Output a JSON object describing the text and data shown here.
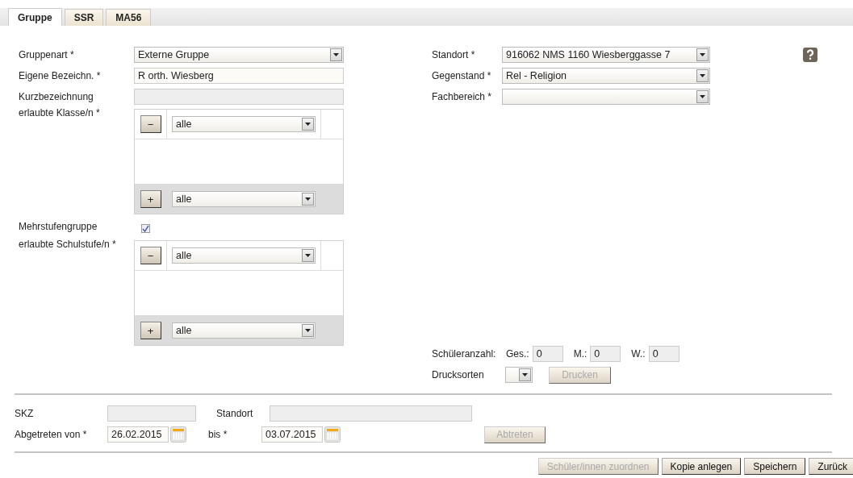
{
  "tabs": [
    {
      "label": "Gruppe",
      "selected": true
    },
    {
      "label": "SSR",
      "selected": false
    },
    {
      "label": "MA56",
      "selected": false
    }
  ],
  "left_fields": [
    {
      "label": "Gruppenart *",
      "kind": "select",
      "value": "Externe Gruppe",
      "disabled": false
    },
    {
      "label": "Eigene Bezeichn. *",
      "kind": "text",
      "value": "R orth. Wiesberg",
      "disabled": false
    },
    {
      "label": "Kurzbezeichnung",
      "kind": "text",
      "disabled": true
    }
  ],
  "klassen": {
    "label": "erlaubte Klasse/n *",
    "remove_button": "−",
    "selected_value": "alle",
    "add_button": "+",
    "add_value": "alle"
  },
  "mehrstufengruppe": {
    "label": "Mehrstufengruppe",
    "checked": true
  },
  "schulstufen": {
    "label": "erlaubte Schulstufe/n *",
    "remove_button": "−",
    "selected_value": "alle",
    "add_button": "+",
    "add_value": "alle"
  },
  "right_fields": [
    {
      "label": "Standort *",
      "kind": "select",
      "value": "916062 NMS 1160 Wiesberggasse 7"
    },
    {
      "label": "Gegenstand *",
      "kind": "select",
      "value": "Rel - Religion"
    },
    {
      "label": "Fachbereich *",
      "kind": "select"
    }
  ],
  "schueleranzahl": {
    "label": "Schüleranzahl:",
    "counts": [
      {
        "label": "Ges.:",
        "value": "0"
      },
      {
        "label": "M.:",
        "value": "0"
      },
      {
        "label": "W.:",
        "value": "0"
      }
    ]
  },
  "drucksorten": {
    "label": "Drucksorten",
    "button": "Drucken",
    "button_disabled": true
  },
  "abtretung": {
    "skz_label": "SKZ",
    "standort_label": "Standort",
    "von_label": "Abgetreten von *",
    "von_value": "26.02.2015",
    "bis_label": "bis *",
    "bis_value": "03.07.2015",
    "button": "Abtreten",
    "button_disabled": true
  },
  "buttons": [
    {
      "label": "Schüler/innen zuordnen",
      "disabled": true
    },
    {
      "label": "Kopie anlegen",
      "disabled": false
    },
    {
      "label": "Speichern",
      "disabled": false
    },
    {
      "label": "Zurück",
      "disabled": false
    }
  ]
}
